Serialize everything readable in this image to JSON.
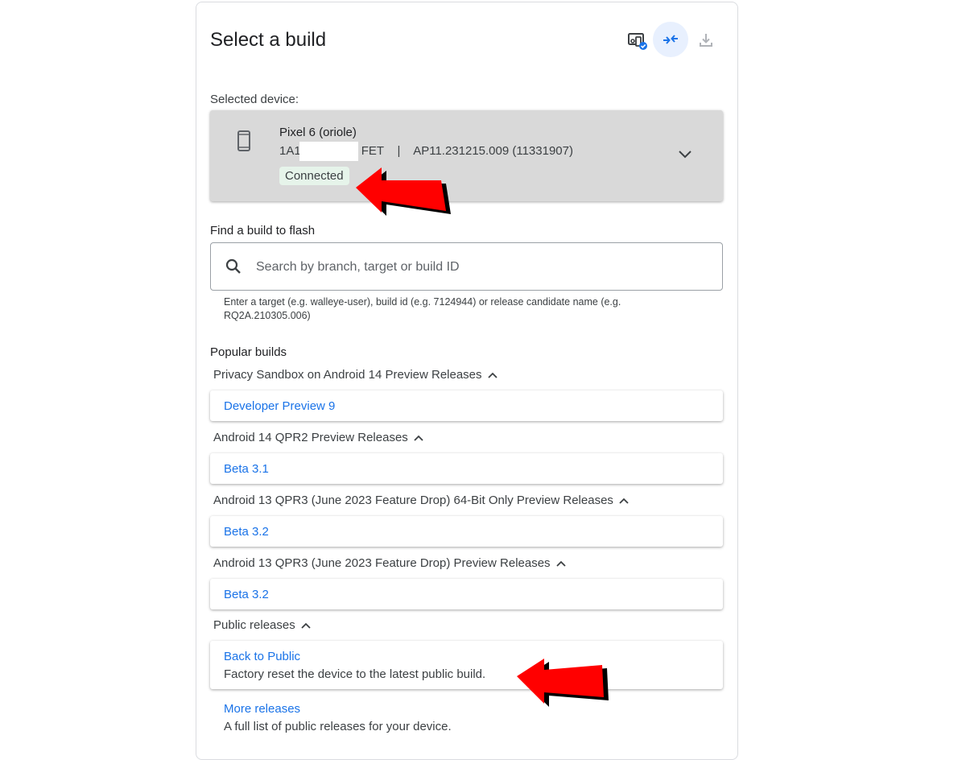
{
  "header": {
    "title": "Select a build",
    "icons": [
      "device-settings-icon",
      "collapse-icon",
      "download-icon"
    ]
  },
  "device": {
    "section_label": "Selected device:",
    "name": "Pixel 6 (oriole)",
    "serial_prefix": "1A1",
    "serial_suffix": "FET",
    "separator": "|",
    "build": "AP11.231215.009 (11331907)",
    "status": "Connected",
    "status_color": "#e6f4ea"
  },
  "search": {
    "label": "Find a build to flash",
    "placeholder": "Search by branch, target or build ID",
    "value": "",
    "hint": "Enter a target (e.g. walleye-user), build id (e.g. 7124944) or release candidate name (e.g. RQ2A.210305.006)"
  },
  "popular": {
    "label": "Popular builds",
    "groups": [
      {
        "title": "Privacy Sandbox on Android 14 Preview Releases",
        "build": "Developer Preview 9"
      },
      {
        "title": "Android 14 QPR2 Preview Releases",
        "build": "Beta 3.1"
      },
      {
        "title": "Android 13 QPR3 (June 2023 Feature Drop) 64-Bit Only Preview Releases",
        "build": "Beta 3.2"
      },
      {
        "title": "Android 13 QPR3 (June 2023 Feature Drop) Preview Releases",
        "build": "Beta 3.2"
      },
      {
        "title": "Public releases",
        "build": "Back to Public",
        "description": "Factory reset the device to the latest public build."
      }
    ]
  },
  "more": {
    "label": "More releases",
    "description": "A full list of public releases for your device."
  },
  "colors": {
    "link": "#1a73e8",
    "accent_bg": "#e8f0fe",
    "annotation_arrow": "#ff0000"
  }
}
